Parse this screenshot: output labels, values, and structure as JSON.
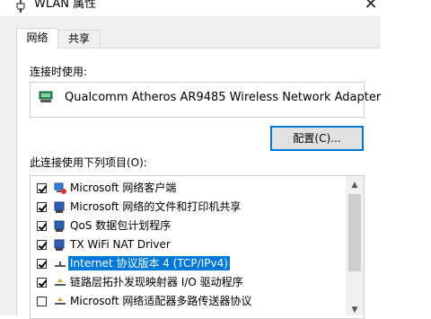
{
  "window": {
    "title": "WLAN 属性",
    "close_glyph": "✕",
    "icon": "network-adapter-icon"
  },
  "tabs": [
    {
      "label": "网络",
      "active": true
    },
    {
      "label": "共享",
      "active": false
    }
  ],
  "connect_using_label": "连接时使用:",
  "adapter": {
    "name": "Qualcomm Atheros AR9485 Wireless Network Adapter",
    "icon": "network-adapter-icon"
  },
  "configure_button": "配置(C)...",
  "items_label": "此连接使用下列项目(O):",
  "items": [
    {
      "label": "Microsoft 网络客户端",
      "checked": true,
      "icon": "network-client-icon",
      "selected": false
    },
    {
      "label": "Microsoft 网络的文件和打印机共享",
      "checked": true,
      "icon": "network-service-icon",
      "selected": false
    },
    {
      "label": "QoS 数据包计划程序",
      "checked": true,
      "icon": "network-service-icon",
      "selected": false
    },
    {
      "label": "TX WiFi NAT Driver",
      "checked": true,
      "icon": "network-service-icon",
      "selected": false
    },
    {
      "label": "Internet 协议版本 4 (TCP/IPv4)",
      "checked": true,
      "icon": "protocol-icon",
      "selected": true
    },
    {
      "label": "链路层拓扑发现映射器 I/O 驱动程序",
      "checked": true,
      "icon": "protocol-icon",
      "selected": false
    },
    {
      "label": "Microsoft 网络适配器多路传送器协议",
      "checked": false,
      "icon": "protocol-icon",
      "selected": false
    }
  ],
  "scrollbar": {
    "up_glyph": "▲",
    "down_glyph": "▼"
  },
  "colors": {
    "selection": "#0078d7",
    "dialog_bg": "#f0f0f0",
    "button_border": "#0078d7"
  }
}
